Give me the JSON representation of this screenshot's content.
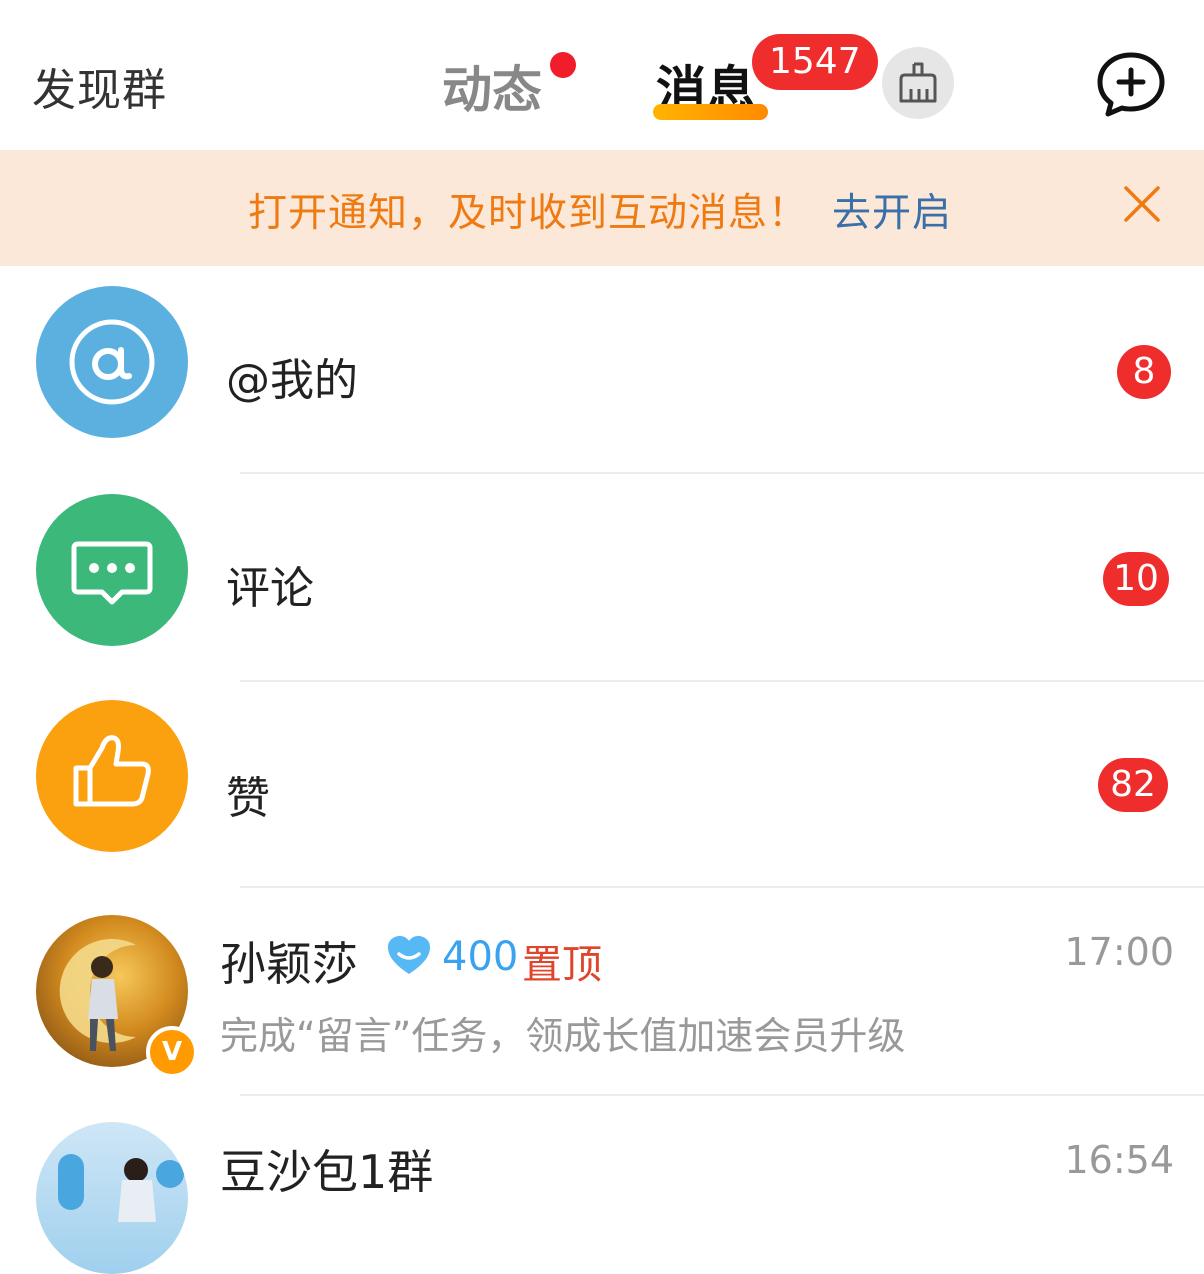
{
  "header": {
    "discover_label": "发现群",
    "tabs": [
      {
        "label": "动态",
        "has_dot": true
      },
      {
        "label": "消息",
        "count": "1547",
        "active": true
      }
    ],
    "broom_icon": "broom-icon",
    "compose_icon": "chat-plus-icon"
  },
  "notice": {
    "text": "打开通知，及时收到互动消息！",
    "link_text": "去开启",
    "close_icon": "close-icon"
  },
  "categories": [
    {
      "label": "@我的",
      "count": "8",
      "icon": "at-icon",
      "color": "#5bb0e0"
    },
    {
      "label": "评论",
      "count": "10",
      "icon": "comment-icon",
      "color": "#3bb87a"
    },
    {
      "label": "赞",
      "count": "82",
      "icon": "thumbs-up-icon",
      "color": "#fba00f"
    }
  ],
  "chats": [
    {
      "name": "孙颖莎",
      "fan_level": "400",
      "pin_label": "置顶",
      "preview": "完成“留言”任务，领成长值加速会员升级",
      "time": "17:00",
      "verified_mark": "V"
    },
    {
      "name": "豆沙包1群",
      "time": "16:54"
    }
  ],
  "colors": {
    "badge_red": "#f02d2d",
    "notice_bg": "#fbe8d8",
    "notice_text": "#f07a12",
    "link_blue": "#3a6fa8",
    "tab_underline": "#ff9a00"
  }
}
